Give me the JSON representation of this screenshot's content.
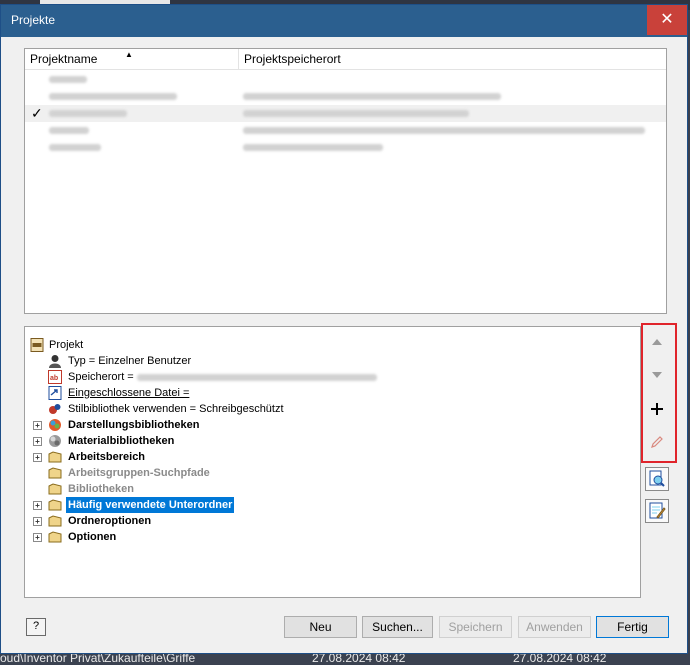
{
  "window": {
    "title": "Projekte",
    "close_symbol": "✕"
  },
  "project_list": {
    "columns": [
      "Projektname",
      "Projektspeicherort"
    ],
    "sort_indicator": "▲",
    "check_mark": "✓"
  },
  "tree": {
    "nodes": [
      {
        "label": "Projekt"
      },
      {
        "label": "Typ = Einzelner Benutzer"
      },
      {
        "label": "Speicherort = "
      },
      {
        "label": "Eingeschlossene Datei = "
      },
      {
        "label": "Stilbibliothek verwenden = Schreibgeschützt"
      },
      {
        "label": "Darstellungsbibliotheken"
      },
      {
        "label": "Materialbibliotheken"
      },
      {
        "label": "Arbeitsbereich"
      },
      {
        "label": "Arbeitsgruppen-Suchpfade"
      },
      {
        "label": "Bibliotheken"
      },
      {
        "label": "Häufig verwendete Unterordner"
      },
      {
        "label": "Ordneroptionen"
      },
      {
        "label": "Optionen"
      }
    ],
    "expander_symbol": "+"
  },
  "buttons": {
    "help": "?",
    "new": "Neu",
    "browse": "Suchen...",
    "save": "Speichern",
    "apply": "Anwenden",
    "done": "Fertig"
  },
  "background": {
    "bottom_text_left": "oud\\Inventor Privat\\Zukaufteile\\Griffe",
    "bottom_text_mid": "27.08.2024 08:42",
    "bottom_text_right": "27.08.2024 08:42"
  }
}
